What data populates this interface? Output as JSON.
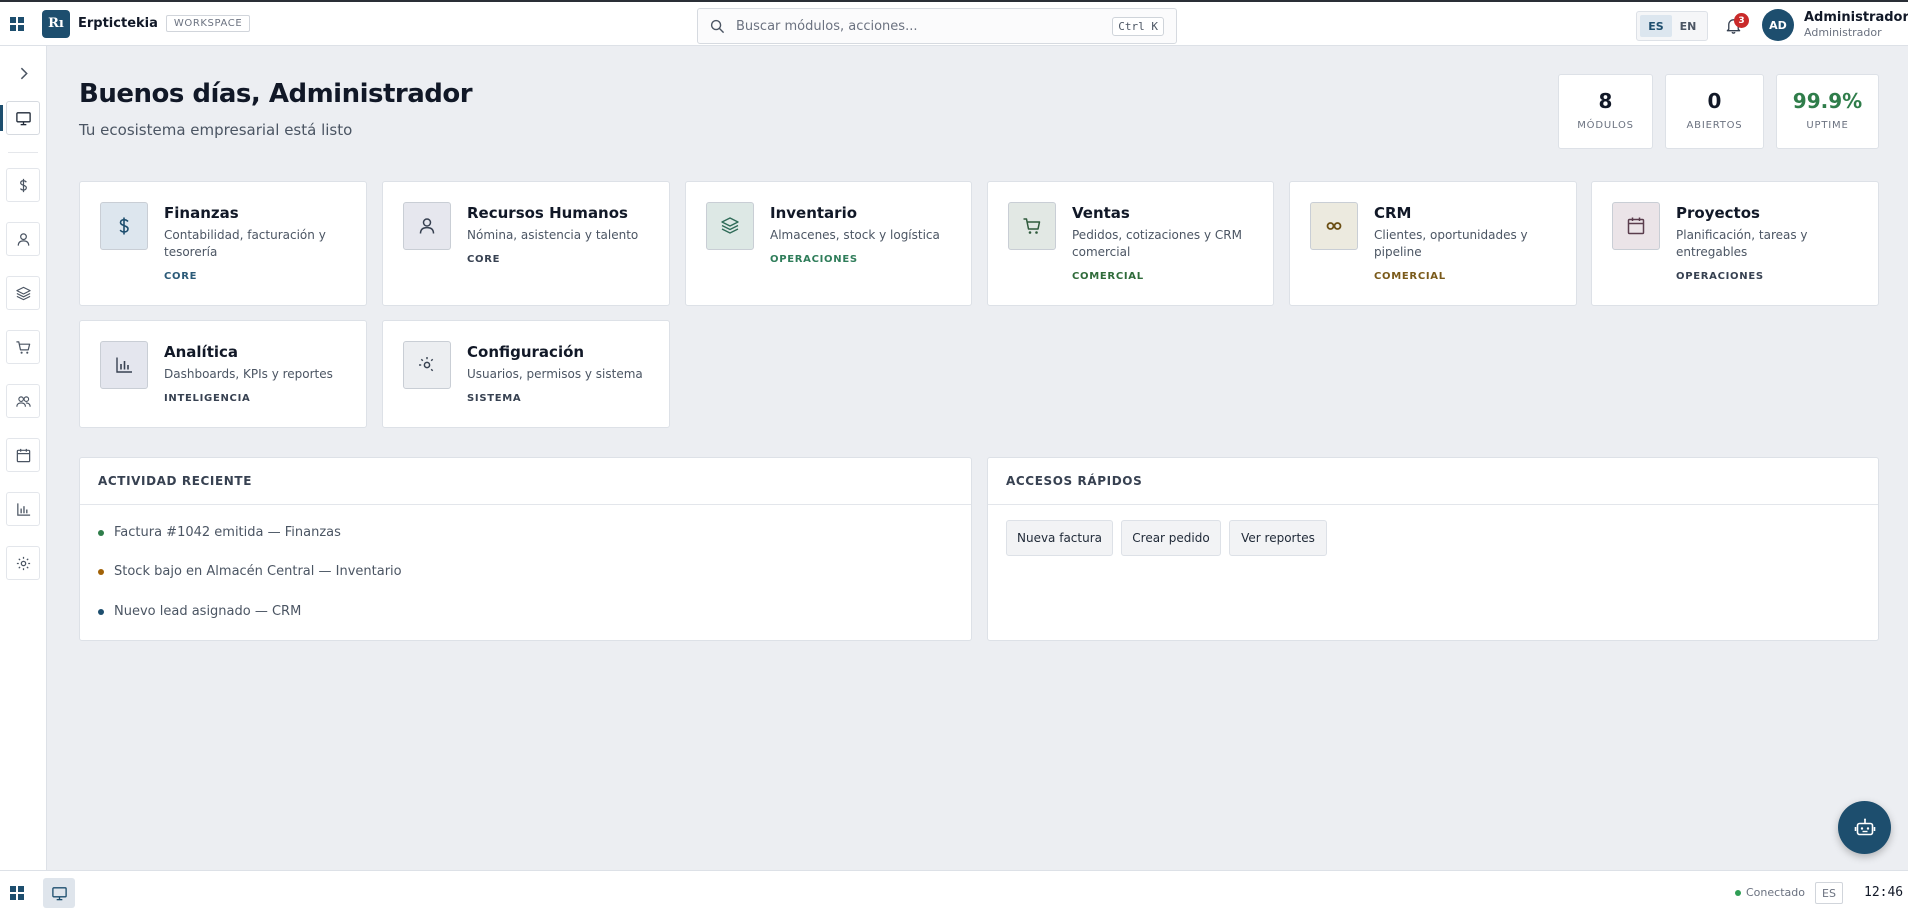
{
  "topbar": {
    "logo_text": "Rı",
    "app_name": "Erptictekia",
    "workspace_badge": "WORKSPACE",
    "search_placeholder": "Buscar módulos, acciones...",
    "search_shortcut": "Ctrl K",
    "languages": [
      "ES",
      "EN"
    ],
    "active_language": "ES",
    "notification_count": "3",
    "avatar_initials": "AD",
    "user_name": "Administrador",
    "user_role": "Administrador"
  },
  "sidebar": {
    "items": [
      {
        "icon": "monitor-icon",
        "active": true
      },
      {
        "icon": "dollar-icon"
      },
      {
        "icon": "user-icon"
      },
      {
        "icon": "layers-icon"
      },
      {
        "icon": "cart-icon"
      },
      {
        "icon": "users-icon"
      },
      {
        "icon": "calendar-icon"
      },
      {
        "icon": "chart-icon"
      },
      {
        "icon": "settings-icon"
      }
    ]
  },
  "header": {
    "greeting": "Buenos días, Administrador",
    "subtitle": "Tu ecosistema empresarial está listo"
  },
  "stats": [
    {
      "value": "8",
      "label": "MÓDULOS"
    },
    {
      "value": "0",
      "label": "ABIERTOS"
    },
    {
      "value": "99.9%",
      "label": "UPTIME"
    }
  ],
  "modules": [
    {
      "title": "Finanzas",
      "desc": "Contabilidad, facturación y tesorería",
      "tag": "CORE",
      "icon": "dollar-icon",
      "tag_color": "#2b5a78",
      "icon_bg": "#dde6ee"
    },
    {
      "title": "Recursos Humanos",
      "desc": "Nómina, asistencia y talento",
      "tag": "CORE",
      "icon": "user-icon",
      "tag_color": "#374151",
      "icon_bg": "#e6e7ee"
    },
    {
      "title": "Inventario",
      "desc": "Almacenes, stock y logística",
      "tag": "OPERACIONES",
      "icon": "layers-icon",
      "tag_color": "#2f7d5a",
      "icon_bg": "#dde8e5"
    },
    {
      "title": "Ventas",
      "desc": "Pedidos, cotizaciones y CRM comercial",
      "tag": "COMERCIAL",
      "icon": "cart-icon",
      "tag_color": "#2f6b3a",
      "icon_bg": "#e2e8e4"
    },
    {
      "title": "CRM",
      "desc": "Clientes, oportunidades y pipeline",
      "tag": "COMERCIAL",
      "icon": "handshake-icon",
      "tag_color": "#7a5a1a",
      "icon_bg": "#eceadf"
    },
    {
      "title": "Proyectos",
      "desc": "Planificación, tareas y entregables",
      "tag": "OPERACIONES",
      "icon": "calendar-icon",
      "tag_color": "#374151",
      "icon_bg": "#ebe4e8"
    },
    {
      "title": "Analítica",
      "desc": "Dashboards, KPIs y reportes",
      "tag": "INTELIGENCIA",
      "icon": "chart-icon",
      "tag_color": "#374151",
      "icon_bg": "#e4e6ee"
    },
    {
      "title": "Configuración",
      "desc": "Usuarios, permisos y sistema",
      "tag": "SISTEMA",
      "icon": "settings-icon",
      "tag_color": "#374151",
      "icon_bg": "#eceef1"
    }
  ],
  "activity": {
    "title": "ACTIVIDAD RECIENTE",
    "items": [
      {
        "text": "Factura #1042 emitida — Finanzas",
        "color": "#2f7d4a"
      },
      {
        "text": "Stock bajo en Almacén Central — Inventario",
        "color": "#a16207"
      },
      {
        "text": "Nuevo lead asignado — CRM",
        "color": "#1d4e6e"
      }
    ]
  },
  "quick_access": {
    "title": "ACCESOS RÁPIDOS",
    "buttons": [
      "Nueva factura",
      "Crear pedido",
      "Ver reportes"
    ]
  },
  "bottombar": {
    "status": "Conectado",
    "language": "ES",
    "clock": "12:46"
  },
  "colors": {
    "accent": "#1d4e6e",
    "background": "#eceef2"
  }
}
